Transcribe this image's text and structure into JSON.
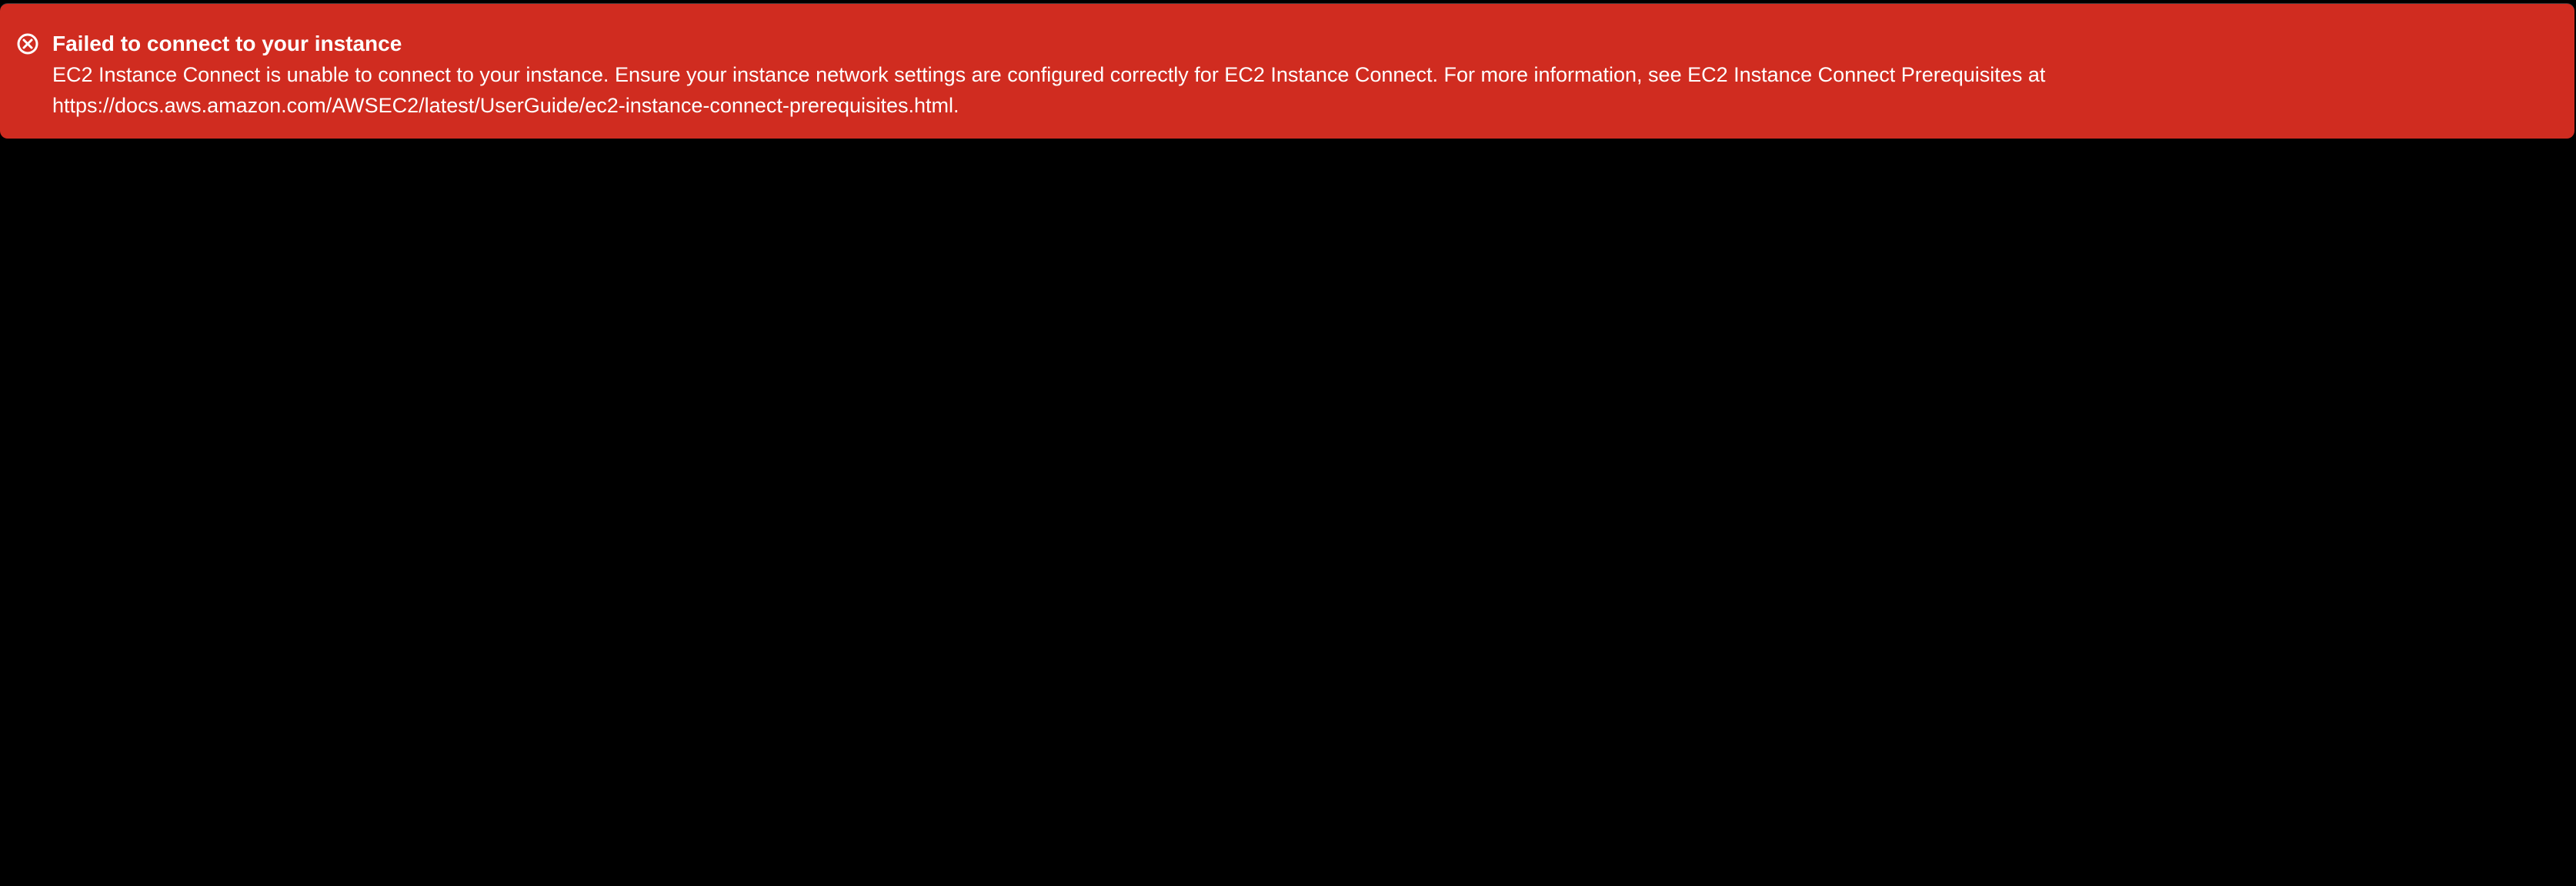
{
  "flashbar": {
    "type": "error",
    "icon": "error-circle-x-icon",
    "color": "#d02c20",
    "title": "Failed to connect to your instance",
    "message_line1": "EC2 Instance Connect is unable to connect to your instance. Ensure your instance network settings are configured correctly for EC2 Instance Connect. For more information, see EC2 Instance Connect Prerequisites at",
    "message_line2": "https://docs.aws.amazon.com/AWSEC2/latest/UserGuide/ec2-instance-connect-prerequisites.html."
  },
  "terminal": {
    "background": "#000000"
  }
}
